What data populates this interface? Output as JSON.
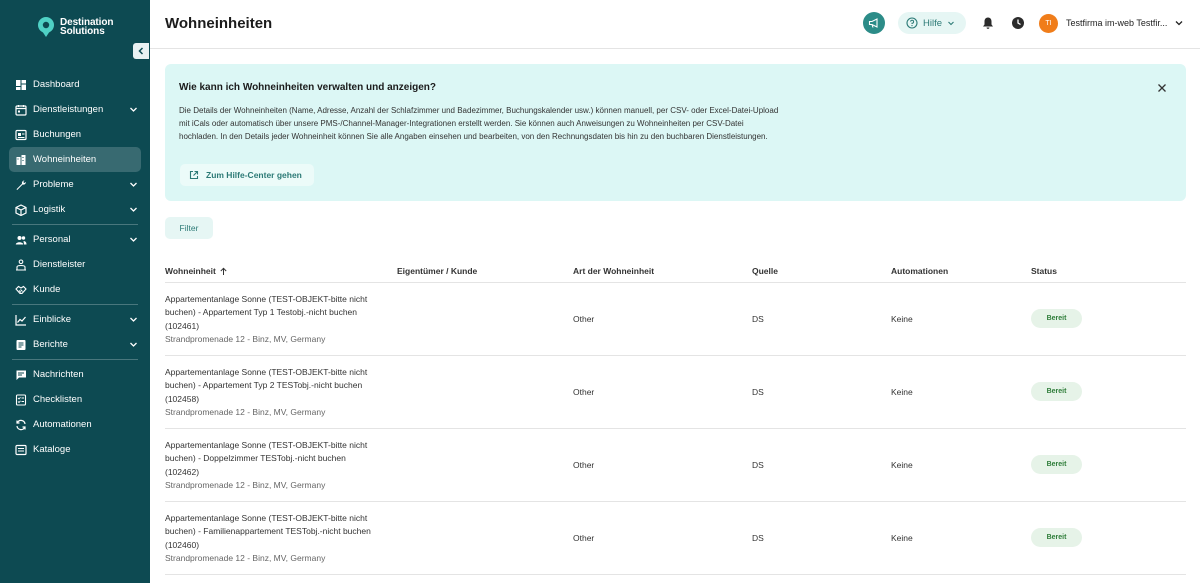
{
  "brand": {
    "line1": "Destination",
    "line2": "Solutions"
  },
  "sidebar": {
    "items": [
      {
        "label": "Dashboard",
        "icon": "dashboard-icon",
        "chevron": false
      },
      {
        "label": "Dienstleistungen",
        "icon": "calendar-icon",
        "chevron": true
      },
      {
        "label": "Buchungen",
        "icon": "booking-icon",
        "chevron": false
      },
      {
        "label": "Wohneinheiten",
        "icon": "building-icon",
        "chevron": false,
        "active": true
      },
      {
        "label": "Probleme",
        "icon": "wrench-icon",
        "chevron": true
      },
      {
        "label": "Logistik",
        "icon": "box-icon",
        "chevron": true
      },
      {
        "label": "Personal",
        "icon": "people-icon",
        "chevron": true
      },
      {
        "label": "Dienstleister",
        "icon": "provider-icon",
        "chevron": false
      },
      {
        "label": "Kunde",
        "icon": "handshake-icon",
        "chevron": false
      },
      {
        "label": "Einblicke",
        "icon": "chart-icon",
        "chevron": true
      },
      {
        "label": "Berichte",
        "icon": "report-icon",
        "chevron": true
      },
      {
        "label": "Nachrichten",
        "icon": "message-icon",
        "chevron": false
      },
      {
        "label": "Checklisten",
        "icon": "checklist-icon",
        "chevron": false
      },
      {
        "label": "Automationen",
        "icon": "automation-icon",
        "chevron": false
      },
      {
        "label": "Kataloge",
        "icon": "catalog-icon",
        "chevron": false
      }
    ]
  },
  "header": {
    "title": "Wohneinheiten",
    "help_label": "Hilfe",
    "avatar_initials": "TI",
    "company": "Testfirma im-web Testfir..."
  },
  "info": {
    "title": "Wie kann ich Wohneinheiten verwalten und anzeigen?",
    "body": "Die Details der Wohneinheiten (Name, Adresse, Anzahl der Schlafzimmer und Badezimmer, Buchungskalender usw.) können manuell, per CSV- oder Excel-Datei-Upload mit iCals oder automatisch über unsere PMS-/Channel-Manager-Integrationen erstellt werden. Sie können auch Anweisungen zu Wohneinheiten per CSV-Datei hochladen. In den Details jeder Wohneinheit können Sie alle Angaben einsehen und bearbeiten, von den Rechnungsdaten bis hin zu den buchbaren Dienstleistungen.",
    "link_label": "Zum Hilfe-Center gehen"
  },
  "filter_label": "Filter",
  "table": {
    "columns": [
      "Wohneinheit",
      "Eigentümer / Kunde",
      "Art der Wohneinheit",
      "Quelle",
      "Automationen",
      "Status"
    ],
    "rows": [
      {
        "name": "Appartementanlage Sonne (TEST-OBJEKT-bitte nicht buchen) - Appartement Typ 1 Testobj.-nicht buchen (102461)",
        "address": "Strandpromenade 12 - Binz, MV, Germany",
        "owner": "",
        "type": "Other",
        "source": "DS",
        "automations": "Keine",
        "status": "Bereit"
      },
      {
        "name": "Appartementanlage Sonne (TEST-OBJEKT-bitte nicht buchen) - Appartement Typ 2 TESTobj.-nicht buchen (102458)",
        "address": "Strandpromenade 12 - Binz, MV, Germany",
        "owner": "",
        "type": "Other",
        "source": "DS",
        "automations": "Keine",
        "status": "Bereit"
      },
      {
        "name": "Appartementanlage Sonne (TEST-OBJEKT-bitte nicht buchen) - Doppelzimmer TESTobj.-nicht buchen (102462)",
        "address": "Strandpromenade 12 - Binz, MV, Germany",
        "owner": "",
        "type": "Other",
        "source": "DS",
        "automations": "Keine",
        "status": "Bereit"
      },
      {
        "name": "Appartementanlage Sonne (TEST-OBJEKT-bitte nicht buchen) - Familienappartement TESTobj.-nicht buchen (102460)",
        "address": "Strandpromenade 12 - Binz, MV, Germany",
        "owner": "",
        "type": "Other",
        "source": "DS",
        "automations": "Keine",
        "status": "Bereit"
      }
    ]
  }
}
